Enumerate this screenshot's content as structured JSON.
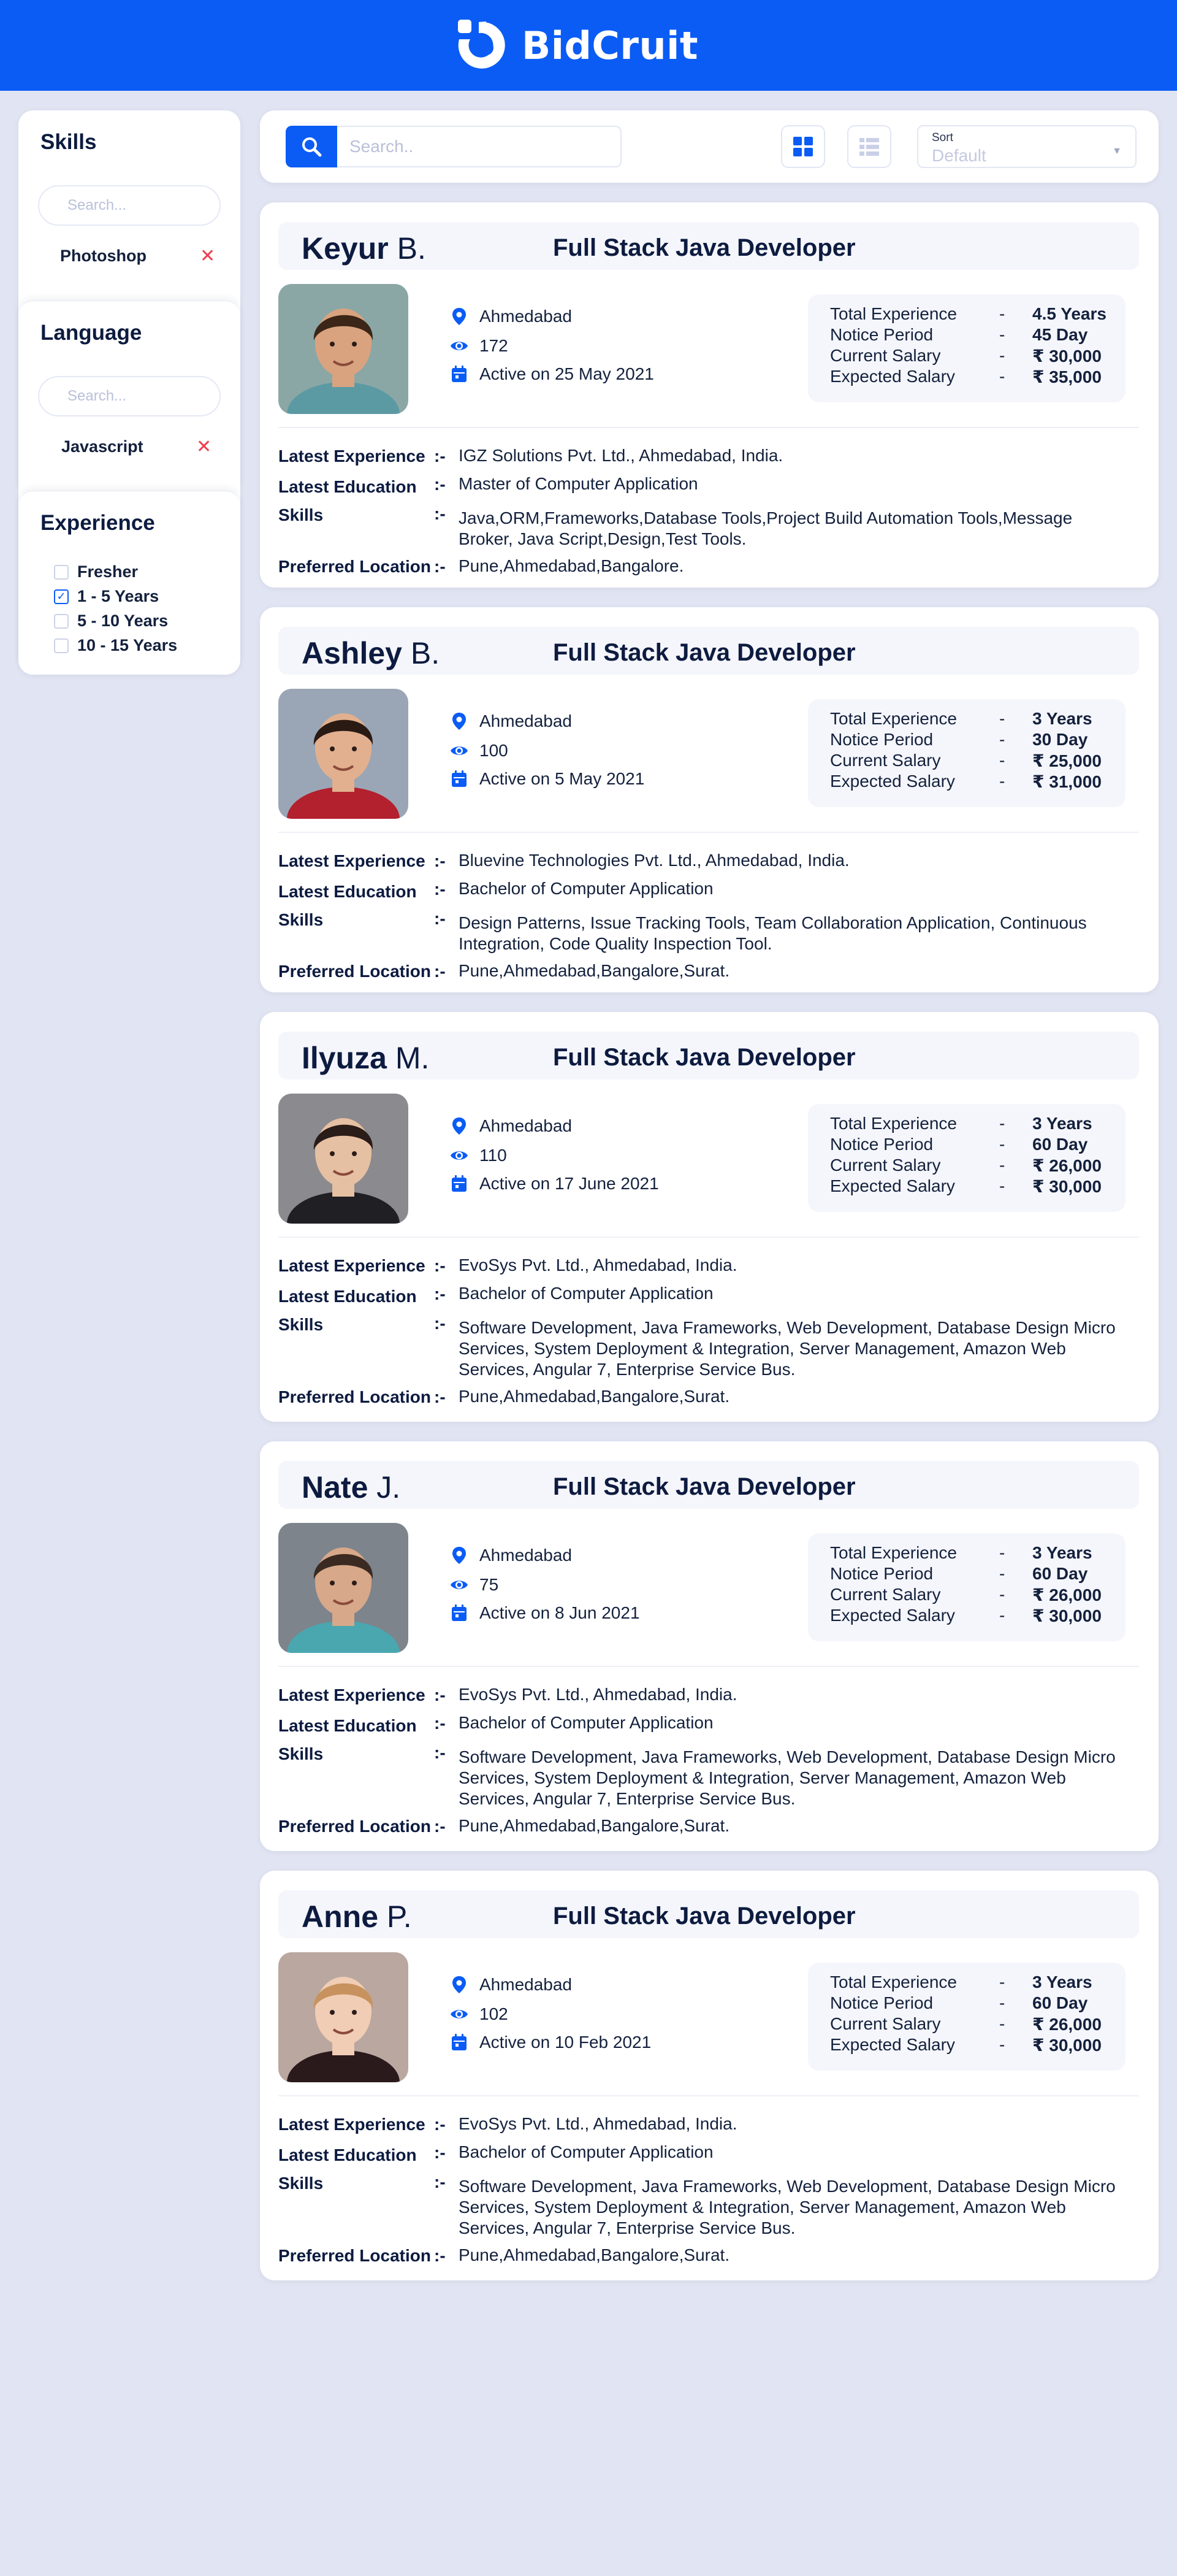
{
  "brand": {
    "name": "BidCruit",
    "color": "#0a5cf5"
  },
  "sidebar": {
    "skills": {
      "title": "Skills",
      "placeholder": "Search...",
      "selected": "Photoshop",
      "remove_icon": "close-icon"
    },
    "language": {
      "title": "Language",
      "placeholder": "Search...",
      "selected": "Javascript",
      "remove_icon": "close-icon"
    },
    "experience": {
      "title": "Experience",
      "options": [
        {
          "label": "Fresher",
          "checked": false
        },
        {
          "label": "1 - 5 Years",
          "checked": true
        },
        {
          "label": "5 - 10 Years",
          "checked": false
        },
        {
          "label": "10 - 15 Years",
          "checked": false
        }
      ]
    }
  },
  "toolbar": {
    "search_placeholder": "Search..",
    "grid_view_icon": "grid-view-icon",
    "list_view_icon": "list-view-icon",
    "sort_label": "Sort",
    "sort_value": "Default"
  },
  "labels": {
    "total_experience": "Total Experience",
    "notice_period": "Notice Period",
    "current_salary": "Current Salary",
    "expected_salary": "Expected Salary",
    "dash": "-",
    "latest_experience": "Latest Experience",
    "latest_education": "Latest Education",
    "skills": "Skills",
    "preferred_location": "Preferred Location",
    "separator": ":-"
  },
  "candidates": [
    {
      "first": "Keyur",
      "last": "B.",
      "title": "Full Stack Java Developer",
      "city": "Ahmedabad",
      "views": "172",
      "active": "Active on 25 May 2021",
      "total_experience": "4.5 Years",
      "notice_period": "45 Day",
      "current_salary": "₹ 30,000",
      "expected_salary": "₹ 35,000",
      "latest_experience": "IGZ Solutions Pvt. Ltd., Ahmedabad, India.",
      "latest_education": "Master of Computer Application",
      "skills": "Java,ORM,Frameworks,Database Tools,Project Build Automation Tools,Message Broker, Java Script,Design,Test Tools.",
      "preferred_location": "Pune,Ahmedabad,Bangalore."
    },
    {
      "first": "Ashley",
      "last": "B.",
      "title": "Full Stack Java Developer",
      "city": "Ahmedabad",
      "views": "100",
      "active": "Active on 5 May 2021",
      "total_experience": "3 Years",
      "notice_period": "30 Day",
      "current_salary": "₹ 25,000",
      "expected_salary": "₹ 31,000",
      "latest_experience": "Bluevine Technologies Pvt. Ltd., Ahmedabad, India.",
      "latest_education": "Bachelor of Computer Application",
      "skills": "Design Patterns, Issue Tracking Tools, Team Collaboration Application, Continuous Integration, Code Quality Inspection Tool.",
      "preferred_location": "Pune,Ahmedabad,Bangalore,Surat."
    },
    {
      "first": "Ilyuza",
      "last": "M.",
      "title": "Full Stack Java Developer",
      "city": "Ahmedabad",
      "views": "110",
      "active": "Active on 17 June 2021",
      "total_experience": "3 Years",
      "notice_period": "60 Day",
      "current_salary": "₹ 26,000",
      "expected_salary": "₹ 30,000",
      "latest_experience": "EvoSys Pvt. Ltd., Ahmedabad, India.",
      "latest_education": "Bachelor of Computer Application",
      "skills": "Software Development, Java Frameworks, Web Development, Database Design Micro Services, System Deployment & Integration, Server Management, Amazon Web Services, Angular 7, Enterprise Service Bus.",
      "preferred_location": "Pune,Ahmedabad,Bangalore,Surat."
    },
    {
      "first": "Nate",
      "last": "J.",
      "title": "Full Stack Java Developer",
      "city": "Ahmedabad",
      "views": "75",
      "active": "Active on 8 Jun 2021",
      "total_experience": "3 Years",
      "notice_period": "60 Day",
      "current_salary": "₹ 26,000",
      "expected_salary": "₹ 30,000",
      "latest_experience": "EvoSys Pvt. Ltd., Ahmedabad, India.",
      "latest_education": "Bachelor of Computer Application",
      "skills": "Software Development, Java Frameworks, Web Development, Database Design Micro Services, System Deployment & Integration, Server Management, Amazon Web Services, Angular 7, Enterprise Service Bus.",
      "preferred_location": "Pune,Ahmedabad,Bangalore,Surat."
    },
    {
      "first": "Anne",
      "last": "P.",
      "title": "Full Stack Java Developer",
      "city": "Ahmedabad",
      "views": "102",
      "active": "Active on 10 Feb 2021",
      "total_experience": "3 Years",
      "notice_period": "60 Day",
      "current_salary": "₹ 26,000",
      "expected_salary": "₹ 30,000",
      "latest_experience": "EvoSys Pvt. Ltd., Ahmedabad, India.",
      "latest_education": "Bachelor of Computer Application",
      "skills": "Software Development, Java Frameworks, Web Development, Database Design Micro Services, System Deployment & Integration, Server Management, Amazon Web Services, Angular 7, Enterprise Service Bus.",
      "preferred_location": "Pune,Ahmedabad,Bangalore,Surat."
    }
  ]
}
